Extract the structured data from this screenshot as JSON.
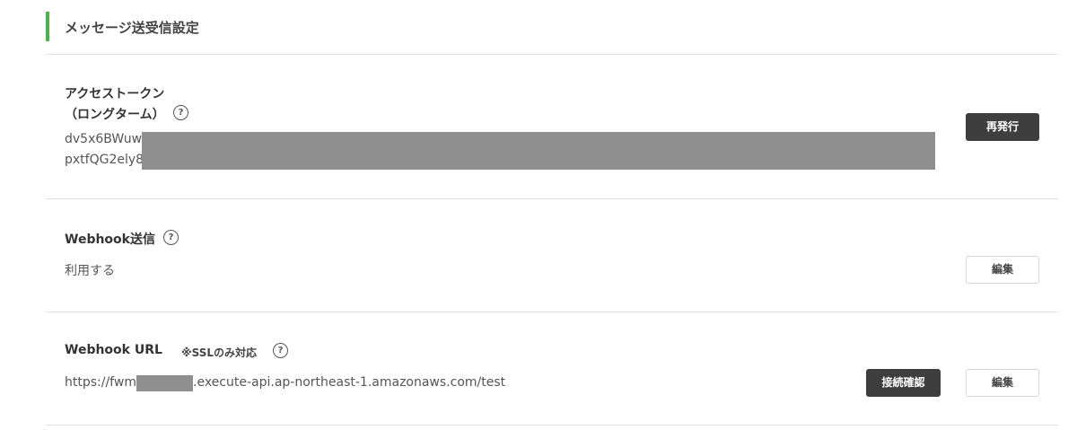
{
  "section": {
    "title": "メッセージ送受信設定",
    "accent_color": "#4cb24f"
  },
  "access_token": {
    "label_line1": "アクセストークン",
    "label_line2": "（ロングターム）",
    "help_icon": "?",
    "value_line1": "dv5x6BWuw",
    "value_line2": "pxtfQG2ely8",
    "reissue_label": "再発行"
  },
  "webhook_send": {
    "label": "Webhook送信",
    "help_icon": "?",
    "value": "利用する",
    "edit_label": "編集"
  },
  "webhook_url": {
    "label": "Webhook URL",
    "note": "※SSLのみ対応",
    "help_icon": "?",
    "value_prefix": "https://fwm",
    "value_suffix": ".execute-api.ap-northeast-1.amazonaws.com/test",
    "verify_label": "接続確認",
    "edit_label": "編集"
  },
  "colors": {
    "dark_button": "#3e3e3e",
    "redaction": "#8f8f8f",
    "divider": "#e1e1e1"
  }
}
